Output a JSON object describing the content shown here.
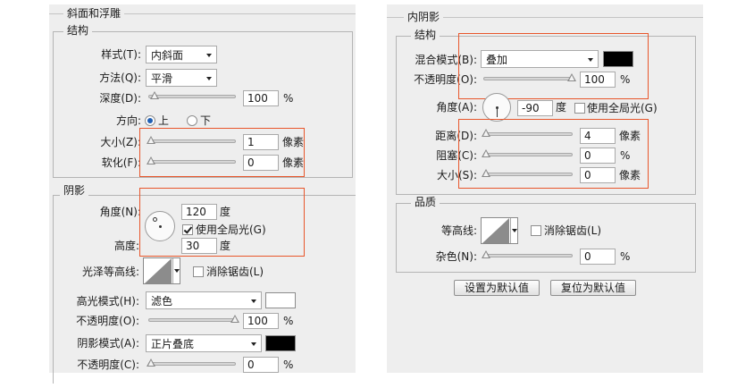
{
  "left": {
    "title": "斜面和浮雕",
    "structure": {
      "title": "结构",
      "style": {
        "label": "样式(T):",
        "value": "内斜面"
      },
      "technique": {
        "label": "方法(Q):",
        "value": "平滑"
      },
      "depth": {
        "label": "深度(D):",
        "value": "100",
        "unit": "%",
        "level": 1.0
      },
      "direction": {
        "label": "方向:",
        "up": "上",
        "down": "下",
        "selected": "上"
      },
      "size": {
        "label": "大小(Z):",
        "value": "1",
        "unit": "像素",
        "level": 0.0
      },
      "soften": {
        "label": "软化(F):",
        "value": "0",
        "unit": "像素",
        "level": 0.0
      }
    },
    "shading": {
      "title": "阴影",
      "angle": {
        "label": "角度(N):",
        "value": "120",
        "unit": "度"
      },
      "global_light": {
        "label": "使用全局光(G)",
        "checked": true
      },
      "altitude": {
        "label": "高度:",
        "value": "30",
        "unit": "度"
      },
      "gloss_contour": {
        "label": "光泽等高线:",
        "anti_alias": "消除锯齿(L)",
        "anti_alias_checked": false
      },
      "highlight_mode": {
        "label": "高光模式(H):",
        "value": "滤色",
        "color": "#ffffff"
      },
      "highlight_opacity": {
        "label": "不透明度(O):",
        "value": "100",
        "unit": "%",
        "level": 1.0
      },
      "shadow_mode": {
        "label": "阴影模式(A):",
        "value": "正片叠底",
        "color": "#000000"
      },
      "shadow_opacity": {
        "label": "不透明度(C):",
        "value": "0",
        "unit": "%",
        "level": 0.0
      }
    }
  },
  "right": {
    "title": "内阴影",
    "structure": {
      "title": "结构",
      "blend_mode": {
        "label": "混合模式(B):",
        "value": "叠加",
        "color": "#000000"
      },
      "opacity": {
        "label": "不透明度(O):",
        "value": "100",
        "unit": "%",
        "level": 1.0
      },
      "angle": {
        "label": "角度(A):",
        "value": "-90",
        "unit": "度"
      },
      "global_light": {
        "label": "使用全局光(G)",
        "checked": false
      },
      "distance": {
        "label": "距离(D):",
        "value": "4",
        "unit": "像素",
        "level": 0.0
      },
      "choke": {
        "label": "阻塞(C):",
        "value": "0",
        "unit": "%",
        "level": 0.0
      },
      "size": {
        "label": "大小(S):",
        "value": "0",
        "unit": "像素",
        "level": 0.0
      }
    },
    "quality": {
      "title": "品质",
      "contour": {
        "label": "等高线:",
        "anti_alias": "消除锯齿(L)",
        "anti_alias_checked": false
      },
      "noise": {
        "label": "杂色(N):",
        "value": "0",
        "unit": "%",
        "level": 0.0
      }
    },
    "buttons": {
      "make_default": "设置为默认值",
      "reset_default": "复位为默认值"
    }
  },
  "colors": {
    "highlight_box": "#e8562b",
    "panel_bg": "#eeeeee"
  },
  "icons": [
    "dropdown-arrow-icon",
    "angle-dial-icon",
    "contour-curve-icon",
    "slider-knob-icon"
  ]
}
